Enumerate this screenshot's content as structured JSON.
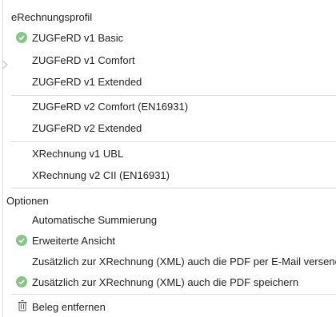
{
  "profile_section": {
    "title": "eRechnungsprofil",
    "items": [
      {
        "label": "ZUGFeRD v1 Basic",
        "selected": true
      },
      {
        "label": "ZUGFeRD v1 Comfort",
        "selected": false
      },
      {
        "label": "ZUGFeRD v1 Extended",
        "selected": false
      },
      {
        "label": "ZUGFeRD v2 Comfort (EN16931)",
        "selected": false
      },
      {
        "label": "ZUGFeRD v2 Extended",
        "selected": false
      },
      {
        "label": "XRechnung v1 UBL",
        "selected": false
      },
      {
        "label": "XRechnung v2 CII (EN16931)",
        "selected": false
      }
    ]
  },
  "options_section": {
    "title": "Optionen",
    "items": [
      {
        "label": "Automatische Summierung",
        "checked": false
      },
      {
        "label": "Erweiterte Ansicht",
        "checked": true
      },
      {
        "label": "Zusätzlich zur XRechnung (XML) auch die PDF per E-Mail versenden",
        "checked": false
      },
      {
        "label": "Zusätzlich zur XRechnung (XML) auch die PDF speichern",
        "checked": true
      }
    ]
  },
  "remove_action": {
    "label": "Beleg entfernen",
    "icon": "trash-icon"
  },
  "colors": {
    "check": "#8bc489",
    "divider": "#dcdcdc",
    "text": "#222222"
  }
}
